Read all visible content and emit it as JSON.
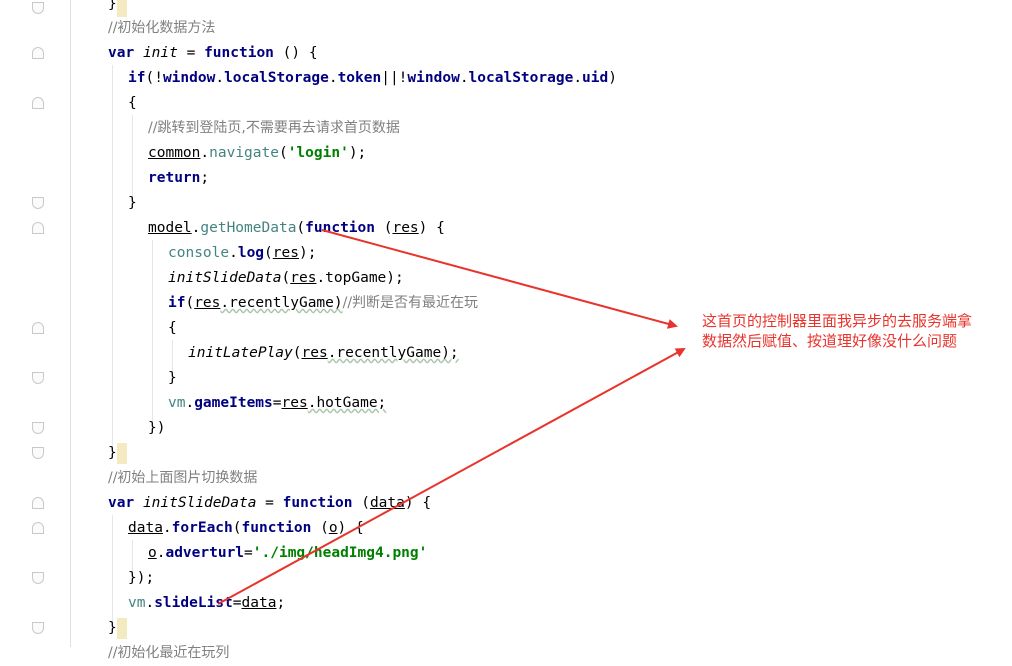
{
  "annotation": {
    "line1": "这首页的控制器里面我异步的去服务端拿",
    "line2": "数据然后赋值、按道理好像没什么问题",
    "color": "#e8342c"
  },
  "code": {
    "l0_brace": "}",
    "l1_comment": "//初始化数据方法",
    "l2": {
      "var": "var",
      "name": "init",
      "eq": " = ",
      "fn": "function",
      "rest": " () {"
    },
    "l3": {
      "if": "if",
      "p1": "(!",
      "w1": "window",
      "d1": ".",
      "ls1": "localStorage",
      "d2": ".",
      "tok": "token",
      "or": "||!",
      "w2": "window",
      "d3": ".",
      "ls2": "localStorage",
      "d4": ".",
      "uid": "uid",
      "close": ")"
    },
    "l4_brace": "{",
    "l5_comment": "//跳转到登陆页,不需要再去请求首页数据",
    "l6": {
      "obj": "common",
      "dot": ".",
      "fn": "navigate",
      "open": "(",
      "str": "'login'",
      "close": ");"
    },
    "l7": {
      "kw": "return",
      "semi": ";"
    },
    "l8_brace": "}",
    "l9": {
      "obj": "model",
      "dot": ".",
      "fn": "getHomeData",
      "open": "(",
      "kw": "function",
      "sp": " (",
      "arg": "res",
      "close": ") {"
    },
    "l10": {
      "obj": "console",
      "dot": ".",
      "fn": "log",
      "open": "(",
      "arg": "res",
      "close": ");"
    },
    "l11": {
      "fn": "initSlideData",
      "open": "(",
      "arg": "res",
      "rest": ".topGame);"
    },
    "l12": {
      "if": "if",
      "open": "(",
      "arg": "res",
      "rest": ".recentlyGame)",
      "cmt": "//判断是否有最近在玩"
    },
    "l13_brace": "{",
    "l14": {
      "fn": "initLatePlay",
      "open": "(",
      "arg": "res",
      "rest": ".recentlyGame);"
    },
    "l15_brace": "}",
    "l16": {
      "obj": "vm",
      "dot": ".",
      "prop": "gameItems",
      "eq": "=",
      "arg": "res",
      "rest": ".hotGame;"
    },
    "l17_close": "})",
    "l18_brace": "}",
    "l19_comment": "//初始上面图片切换数据",
    "l20": {
      "var": "var",
      "name": "initSlideData",
      "eq": " = ",
      "fn": "function",
      "sp": " (",
      "arg": "data",
      "close": ") {"
    },
    "l21": {
      "obj": "data",
      "dot": ".",
      "fn": "forEach",
      "open": "(",
      "kw": "function",
      "sp": " (",
      "arg": "o",
      "close": ") {"
    },
    "l22": {
      "obj": "o",
      "dot": ".",
      "prop": "adverturl",
      "eq": "=",
      "str": "'./img/headImg4.png'"
    },
    "l23_close": "});",
    "l24": {
      "obj": "vm",
      "dot": ".",
      "prop": "slideList",
      "eq": "=",
      "arg": "data",
      "semi": ";"
    },
    "l25_brace": "}",
    "l26_comment": "//初始化最近在玩列"
  }
}
